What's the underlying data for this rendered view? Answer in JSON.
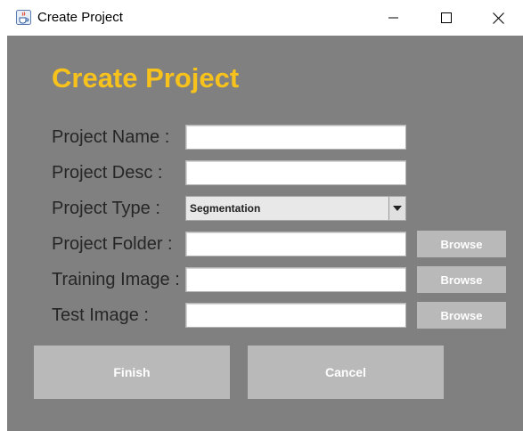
{
  "window": {
    "title": "Create Project",
    "icon": "java-cup-icon",
    "controls": [
      "minimize-icon",
      "maximize-icon",
      "close-icon"
    ]
  },
  "form": {
    "heading": "Create Project",
    "fields": {
      "project_name": {
        "label": "Project Name :",
        "value": ""
      },
      "project_desc": {
        "label": "Project Desc :",
        "value": ""
      },
      "project_type": {
        "label": "Project Type :",
        "value": "Segmentation"
      },
      "project_folder": {
        "label": "Project Folder :",
        "value": ""
      },
      "training_image": {
        "label": "Training Image :",
        "value": ""
      },
      "test_image": {
        "label": "Test Image :",
        "value": ""
      }
    },
    "browse_label": "Browse",
    "finish_label": "Finish",
    "cancel_label": "Cancel"
  },
  "colors": {
    "background": "#808080",
    "heading": "#f7c21b",
    "button": "#b9b9b9",
    "button_text": "#ffffff",
    "label_text": "#262626"
  }
}
